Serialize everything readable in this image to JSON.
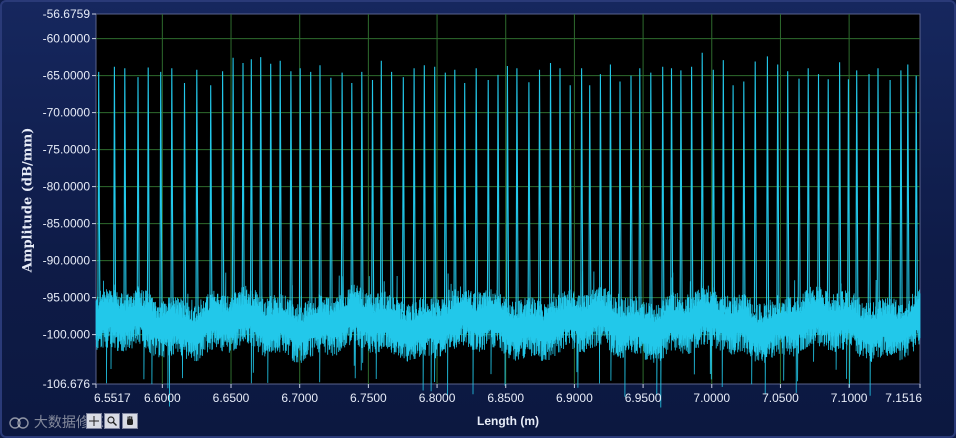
{
  "chart_data": {
    "type": "line",
    "title": "",
    "xlabel": "Length (m)",
    "ylabel": "Amplitude (dB/mm)",
    "xlim": [
      6.5517,
      7.1516
    ],
    "ylim": [
      -106.676,
      -56.6759
    ],
    "x_ticks": [
      "6.5517",
      "6.6000",
      "6.6500",
      "6.7000",
      "6.7500",
      "6.8000",
      "6.8500",
      "6.9000",
      "6.9500",
      "7.0000",
      "7.0500",
      "7.1000",
      "7.1516"
    ],
    "x_tick_values": [
      6.5517,
      6.6,
      6.65,
      6.7,
      6.75,
      6.8,
      6.85,
      6.9,
      6.95,
      7.0,
      7.05,
      7.1,
      7.1516
    ],
    "y_ticks": [
      "-56.6759",
      "-60.0000",
      "-65.0000",
      "-70.0000",
      "-75.0000",
      "-80.0000",
      "-85.0000",
      "-90.0000",
      "-95.0000",
      "-100.000",
      "-106.676"
    ],
    "y_tick_values": [
      -56.6759,
      -60,
      -65,
      -70,
      -75,
      -80,
      -85,
      -90,
      -95,
      -100,
      -106.676
    ],
    "grid": true,
    "series": [
      {
        "color": "#22c8ea",
        "noise_floor_mean": -98.5,
        "noise_floor_spread": 2.2,
        "peak_count": 61,
        "peaks_x": [
          6.5537,
          6.5651,
          6.5727,
          6.5823,
          6.5897,
          6.5988,
          6.6069,
          6.6161,
          6.6251,
          6.6352,
          6.6439,
          6.6515,
          6.6587,
          6.6648,
          6.6716,
          6.6789,
          6.6858,
          6.6936,
          6.7004,
          6.708,
          6.7148,
          6.7227,
          6.7309,
          6.7379,
          6.7452,
          6.753,
          6.7594,
          6.7669,
          6.7754,
          6.7833,
          6.7907,
          6.7983,
          6.806,
          6.8129,
          6.8201,
          6.8285,
          6.8372,
          6.8444,
          6.8512,
          6.8581,
          6.8669,
          6.8746,
          6.8826,
          6.8895,
          6.8969,
          6.9052,
          6.9111,
          6.9189,
          6.9262,
          6.9332,
          6.9412,
          6.9476,
          6.9556,
          6.9643,
          6.9707,
          6.9775,
          6.9853,
          6.993,
          7.0011,
          7.0084,
          7.0155,
          7.0233,
          7.0316,
          7.0405,
          7.048,
          7.0553,
          7.0635,
          7.0702,
          7.0777,
          7.0848,
          7.0931,
          7.0995,
          7.1055,
          7.1145,
          7.121,
          7.1298,
          7.1377,
          7.1427,
          7.1488
        ],
        "peaks_y": [
          -64.5,
          -63.8,
          -64.0,
          -65.2,
          -63.9,
          -64.5,
          -64.0,
          -66.0,
          -64.2,
          -66.3,
          -64.4,
          -62.6,
          -63.3,
          -62.8,
          -62.5,
          -63.4,
          -63.0,
          -64.4,
          -64.0,
          -64.5,
          -63.6,
          -65.3,
          -64.6,
          -66.0,
          -64.5,
          -65.6,
          -63.0,
          -64.5,
          -65.2,
          -64.0,
          -63.6,
          -63.8,
          -64.6,
          -64.2,
          -66.0,
          -64.0,
          -65.6,
          -64.9,
          -63.7,
          -64.0,
          -65.9,
          -64.2,
          -63.3,
          -64.0,
          -66.3,
          -64.0,
          -66.3,
          -64.8,
          -63.5,
          -65.8,
          -65.0,
          -64.0,
          -64.6,
          -63.8,
          -64.0,
          -64.3,
          -63.8,
          -61.9,
          -64.2,
          -62.9,
          -66.3,
          -65.8,
          -63.1,
          -62.4,
          -63.5,
          -64.4,
          -65.4,
          -64.0,
          -64.8,
          -65.5,
          -63.2,
          -65.5,
          -64.3,
          -64.8,
          -64.0,
          -65.6,
          -64.3,
          -63.5,
          -65.0
        ]
      }
    ]
  },
  "toolbar": {
    "zoom_icon": "magnifier-icon",
    "pan_icon": "hand-icon",
    "cursor_icon": "crosshair-icon"
  },
  "watermark": {
    "text": "大数据修炼"
  },
  "colors": {
    "panel_bg": "#0f1d4a",
    "plot_bg": "#000000",
    "grid": "#2e6b2e",
    "trace": "#22c8ea",
    "axis_text": "#e7ecf8"
  }
}
